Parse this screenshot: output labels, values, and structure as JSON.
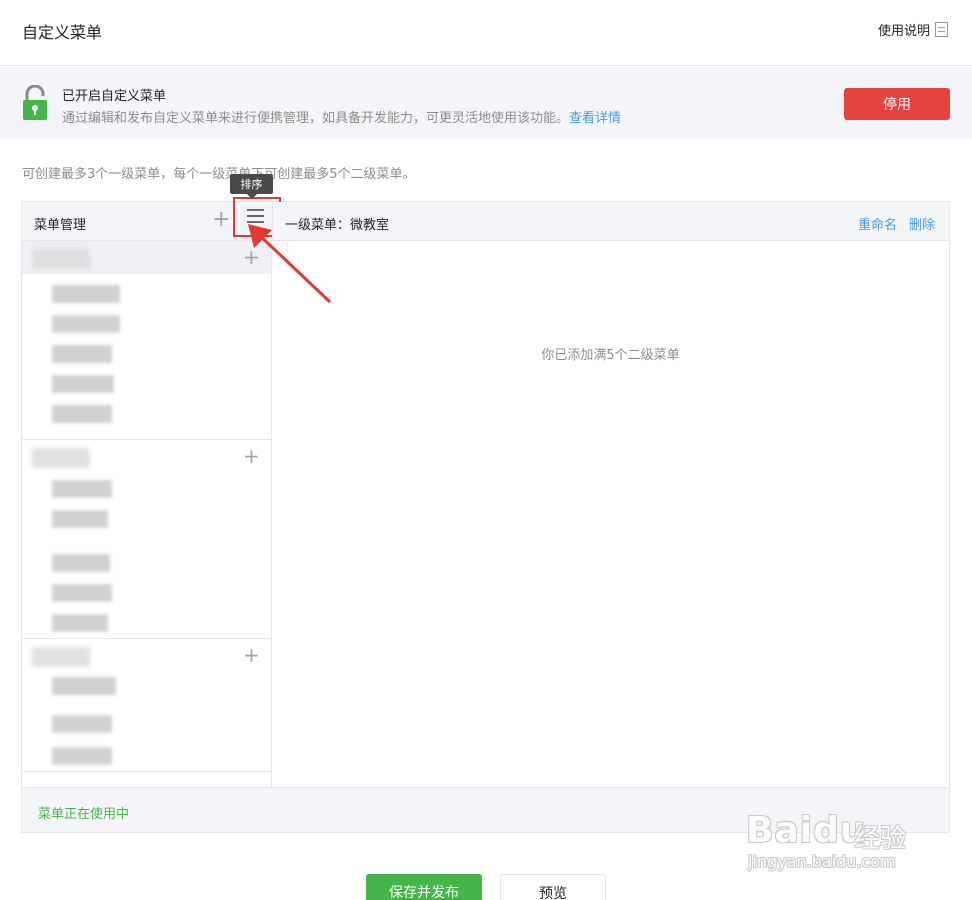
{
  "header": {
    "title": "自定义菜单",
    "help_label": "使用说明"
  },
  "status": {
    "title": "已开启自定义菜单",
    "description": "通过编辑和发布自定义菜单来进行便携管理，如具备开发能力，可更灵活地使用该功能。",
    "details_link": "查看详情",
    "stop_button": "停用"
  },
  "limit_note": "可创建最多3个一级菜单，每个一级菜单下可创建最多5个二级菜单。",
  "tooltip": "排序",
  "menu_panel": {
    "left_title": "菜单管理",
    "add_symbol": "+",
    "right_title": "一级菜单：微教室",
    "rename_label": "重命名",
    "delete_label": "删除",
    "empty_message": "你已添加满5个二级菜单",
    "footer_status": "菜单正在使用中",
    "groups": [
      {
        "parent": "blurred",
        "sub_items": 5
      },
      {
        "parent": "blurred",
        "sub_items": 5
      },
      {
        "parent": "blurred",
        "sub_items": 3
      }
    ]
  },
  "actions": {
    "publish": "保存并发布",
    "preview": "预览"
  },
  "watermark": {
    "brand": "Baidu",
    "product": "经验",
    "url": "jingyan.baidu.com"
  },
  "colors": {
    "accent_red": "#e64340",
    "accent_green": "#44b549",
    "link_blue": "#459ae9",
    "annotation_red": "#e23a2f"
  },
  "icons": [
    "doc-icon",
    "lock-icon",
    "plus-icon",
    "sort-icon",
    "arrow-annotation"
  ]
}
